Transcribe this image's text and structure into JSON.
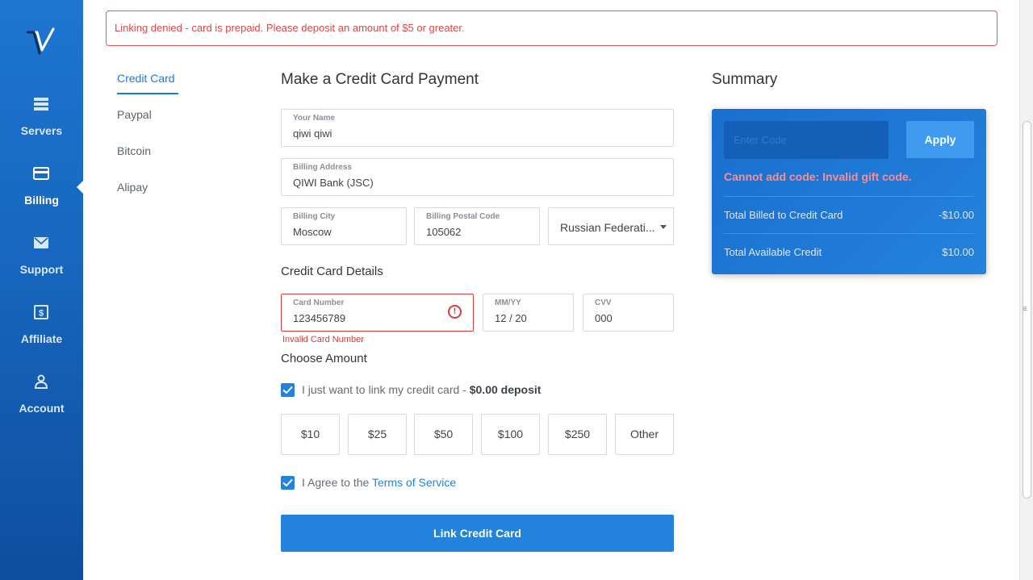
{
  "sidebar": {
    "items": [
      {
        "label": "Servers",
        "icon": "servers-icon"
      },
      {
        "label": "Billing",
        "icon": "credit-card-icon",
        "active": true
      },
      {
        "label": "Support",
        "icon": "envelope-icon"
      },
      {
        "label": "Affiliate",
        "icon": "dollar-icon"
      },
      {
        "label": "Account",
        "icon": "user-icon"
      }
    ]
  },
  "alert": {
    "message": "Linking denied - card is prepaid. Please deposit an amount of $5 or greater."
  },
  "methods": [
    "Credit Card",
    "Paypal",
    "Bitcoin",
    "Alipay"
  ],
  "form": {
    "title": "Make a Credit Card Payment",
    "name": {
      "label": "Your Name",
      "value": "qiwi qiwi"
    },
    "address": {
      "label": "Billing Address",
      "value": "QIWI Bank (JSC)"
    },
    "city": {
      "label": "Billing City",
      "value": "Moscow"
    },
    "postal": {
      "label": "Billing Postal Code",
      "value": "105062"
    },
    "country": {
      "value": "Russian Federati..."
    },
    "card_section_title": "Credit Card Details",
    "card_number": {
      "label": "Card Number",
      "value": "123456789",
      "error": "Invalid Card Number"
    },
    "expiry": {
      "label": "MM/YY",
      "value": "12 / 20"
    },
    "cvv": {
      "label": "CVV",
      "value": "000"
    },
    "amount_title": "Choose Amount",
    "link_only_text": "I just want to link my credit card -",
    "link_only_bold": "$0.00 deposit",
    "amounts": [
      "$10",
      "$25",
      "$50",
      "$100",
      "$250",
      "Other"
    ],
    "terms_text": "I Agree to the",
    "terms_link": "Terms of Service",
    "submit_label": "Link Credit Card"
  },
  "summary": {
    "title": "Summary",
    "code_placeholder": "Enter Code",
    "apply_label": "Apply",
    "code_error": "Cannot add code: Invalid gift code.",
    "rows": [
      {
        "label": "Total Billed to Credit Card",
        "value": "-$10.00"
      },
      {
        "label": "Total Available Credit",
        "value": "$10.00"
      }
    ]
  },
  "colors": {
    "accent": "#2383dc",
    "error": "#d93b3b",
    "sidebar": "#1766bf"
  }
}
